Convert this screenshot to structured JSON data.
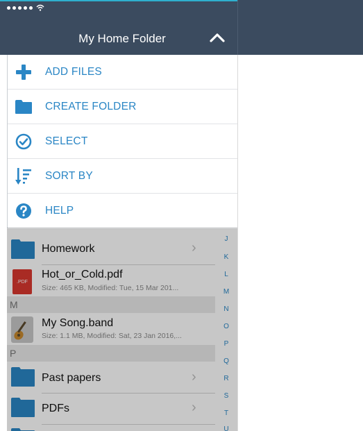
{
  "status_bar": {
    "signal_dots": 5,
    "wifi": "wifi-icon"
  },
  "header": {
    "title": "My Home Folder",
    "toggle_icon": "chevron-up-icon"
  },
  "menu": {
    "items": [
      {
        "label": "ADD FILES",
        "icon": "plus-icon"
      },
      {
        "label": "CREATE FOLDER",
        "icon": "folder-icon"
      },
      {
        "label": "SELECT",
        "icon": "checkmark-circle-icon"
      },
      {
        "label": "SORT BY",
        "icon": "sort-icon"
      },
      {
        "label": "HELP",
        "icon": "help-icon"
      }
    ]
  },
  "list": {
    "rows": [
      {
        "title": "Homework",
        "type": "folder"
      },
      {
        "title": "Hot_or_Cold.pdf",
        "meta": "Size: 465 KB, Modified: Tue, 15 Mar 201...",
        "type": "pdf",
        "badge": ".PDF"
      },
      {
        "title": "My Song.band",
        "meta": "Size: 1.1 MB, Modified: Sat, 23 Jan 2016,...",
        "type": "band"
      },
      {
        "title": "Past papers",
        "type": "folder"
      },
      {
        "title": "PDFs",
        "type": "folder"
      }
    ],
    "sections": [
      "M",
      "P"
    ],
    "index_letters": [
      "J",
      "K",
      "L",
      "M",
      "N",
      "O",
      "P",
      "Q",
      "R",
      "S",
      "T",
      "U"
    ]
  },
  "colors": {
    "header_bg": "#3b4b5f",
    "accent": "#2a86c5",
    "folder": "#2a86c5",
    "pdf": "#d9382f"
  }
}
